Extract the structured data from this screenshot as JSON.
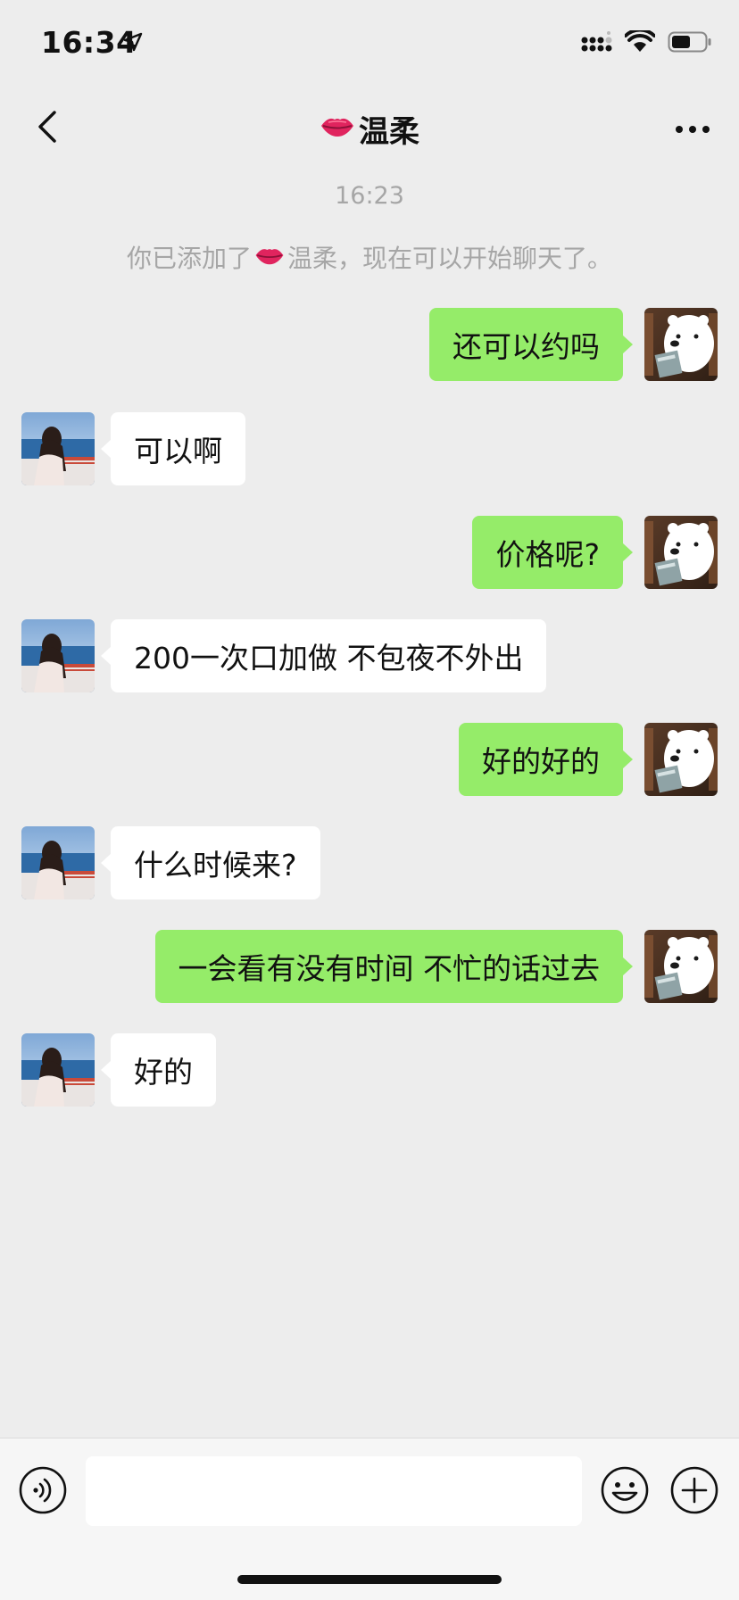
{
  "status_bar": {
    "time": "16:34",
    "icons": [
      "location-arrow-icon",
      "signal-icon",
      "wifi-icon",
      "battery-icon"
    ]
  },
  "header": {
    "title": "温柔",
    "title_emoji": "lips-emoji",
    "back_icon": "chevron-left-icon",
    "more_icon": "more-dots-icon"
  },
  "chat": {
    "timestamp": "16:23",
    "system_message_prefix": "你已添加了",
    "system_message_name": "温柔",
    "system_message_suffix": "，现在可以开始聊天了。",
    "messages": [
      {
        "side": "right",
        "text": "还可以约吗"
      },
      {
        "side": "left",
        "text": "可以啊"
      },
      {
        "side": "right",
        "text": "价格呢?"
      },
      {
        "side": "left",
        "text": "200一次口加做 不包夜不外出"
      },
      {
        "side": "right",
        "text": "好的好的"
      },
      {
        "side": "left",
        "text": "什么时候来?"
      },
      {
        "side": "right",
        "text": "一会看有没有时间 不忙的话过去"
      },
      {
        "side": "left",
        "text": "好的"
      }
    ]
  },
  "input_bar": {
    "value": "",
    "icons": [
      "voice-icon",
      "emoji-icon",
      "plus-icon"
    ]
  },
  "colors": {
    "background": "#ededed",
    "sent_bubble": "#95ec69",
    "received_bubble": "#ffffff",
    "muted_text": "#a6a6a6"
  }
}
